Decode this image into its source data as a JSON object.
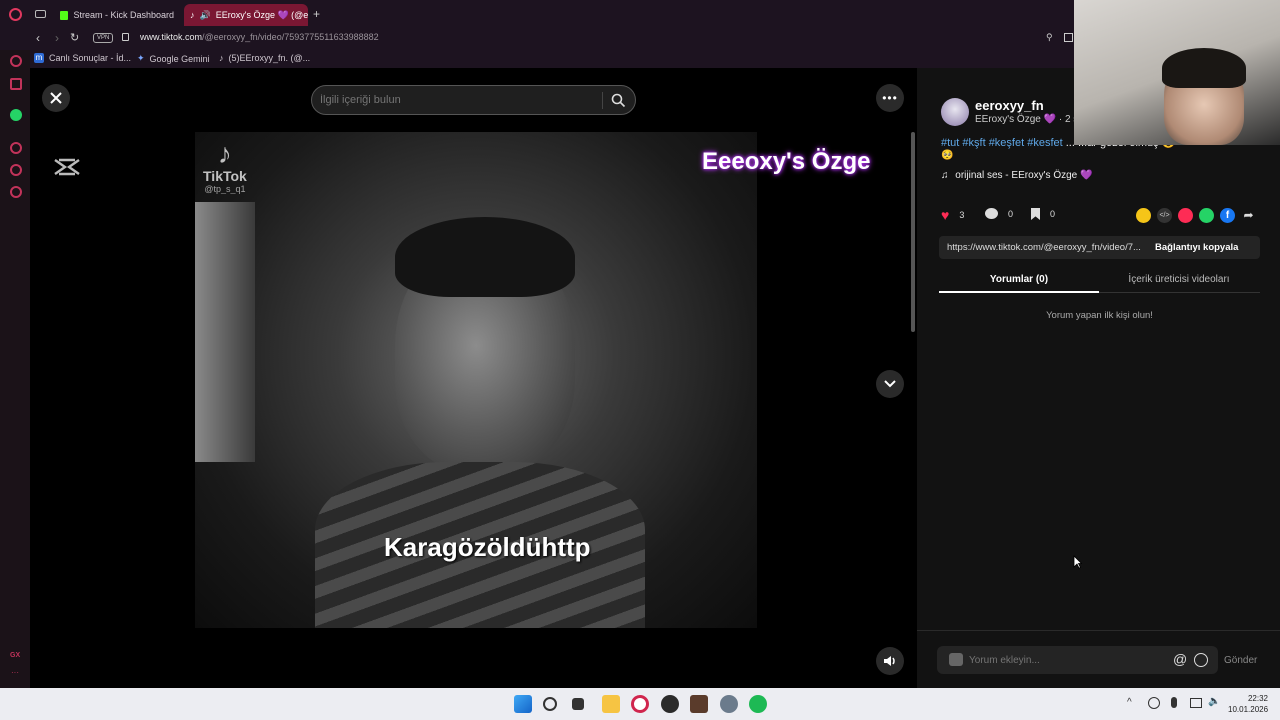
{
  "browser": {
    "tabs": [
      {
        "label": "Stream - Kick Dashboard",
        "active": false
      },
      {
        "label": "EEroxy's Özge 💜 (@e",
        "active": true
      }
    ],
    "vpn_label": "VPN",
    "url_host": "www.tiktok.com",
    "url_path": "/@eeroxyy_fn/video/7593775511633988882",
    "bookmarks": [
      "Canlı Sonuçlar - İd...",
      "Google Gemini",
      "(5)EEroxyy_fn. (@..."
    ]
  },
  "sidebar": {
    "bottom_label": "GX"
  },
  "search": {
    "placeholder": "İlgili içeriği bulun"
  },
  "video": {
    "overlay_title": "Eeeoxy's Özge",
    "watermark": "TikTok",
    "watermark_user": "@tp_s_q1",
    "subtitle": "Karagözöldühttp"
  },
  "post": {
    "username": "eeroxyy_fn",
    "display_name": "EEroxy's Özge 💜",
    "time_ago": "· 2 sa",
    "hashtags": "#tut #kşft #keşfet #kesfet",
    "hashtags_tail": "... ...ar gözel olmuş 😍",
    "emoji_line": "🥺",
    "sound": "orijinal ses - EEroxy's Özge 💜",
    "likes": "3",
    "comments": "0",
    "saves": "0",
    "link": "https://www.tiktok.com/@eeroxyy_fn/video/7...",
    "copy_link_label": "Bağlantıyı kopyala"
  },
  "panel_tabs": {
    "comments": "Yorumlar (0)",
    "creator_videos": "İçerik üreticisi videoları"
  },
  "empty_comments": "Yorum yapan ilk kişi olun!",
  "comment_box": {
    "placeholder": "Yorum ekleyin...",
    "send_label": "Gönder"
  },
  "taskbar": {
    "time": "22:32",
    "date": "10.01.2026"
  },
  "colors": {
    "accent": "#fe2c55",
    "browser_accent": "#c2335a",
    "link": "#5fa8e8"
  },
  "icons": [
    "close-icon",
    "search-icon",
    "more-icon",
    "chevron-down-icon",
    "volume-icon",
    "heart-icon",
    "comment-icon",
    "bookmark-icon",
    "music-note-icon",
    "share-icon"
  ]
}
